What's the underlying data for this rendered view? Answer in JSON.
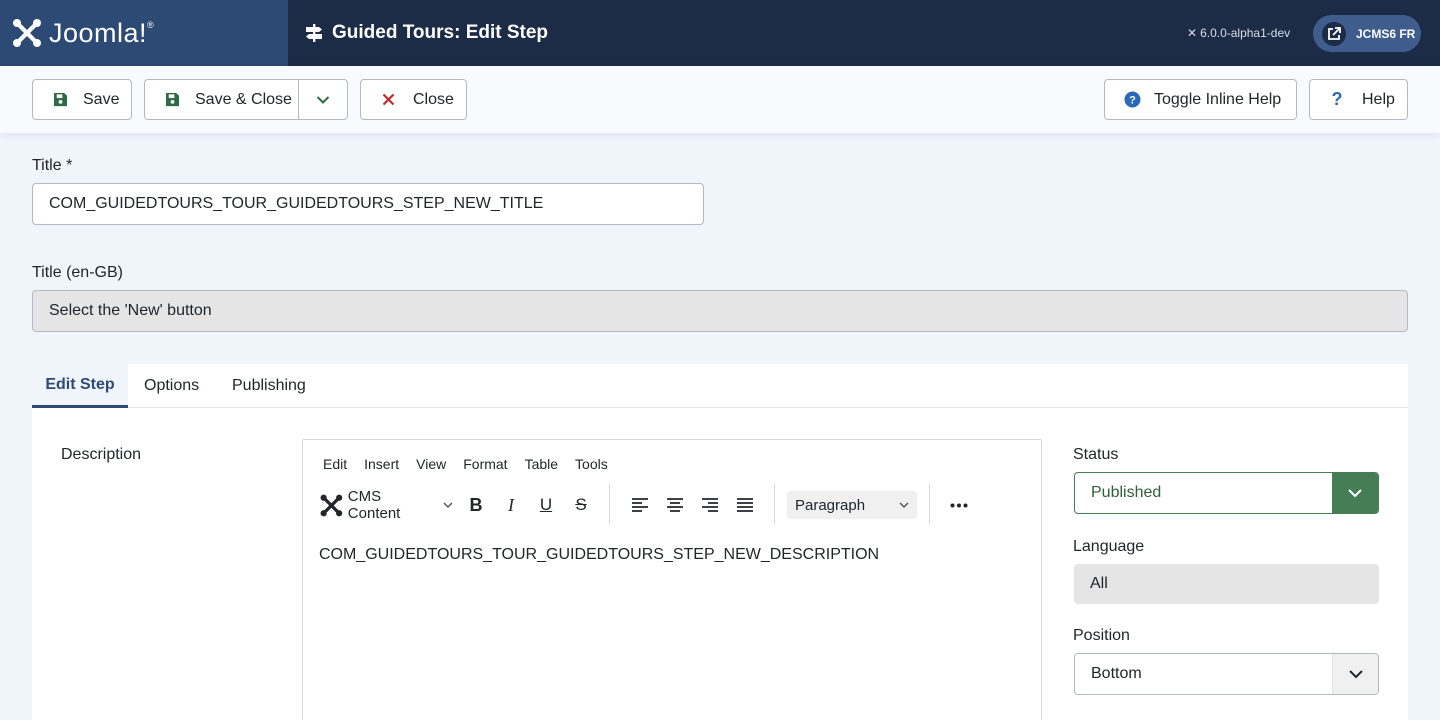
{
  "header": {
    "brand": "Joomla!",
    "brand_mark": "joomla-logo",
    "title": "Guided Tours: Edit Step",
    "version": "6.0.0-alpha1-dev",
    "site_label": "JCMS6 FR"
  },
  "toolbar": {
    "save_label": "Save",
    "save_close_label": "Save & Close",
    "close_label": "Close",
    "toggle_inline_help_label": "Toggle Inline Help",
    "help_label": "Help"
  },
  "form": {
    "title_label": "Title *",
    "title_value": "COM_GUIDEDTOURS_TOUR_GUIDEDTOURS_STEP_NEW_TITLE",
    "title_translation_label": "Title (en-GB)",
    "title_translation_value": "Select the 'New' button"
  },
  "tabs": [
    {
      "label": "Edit Step",
      "active": true
    },
    {
      "label": "Options",
      "active": false
    },
    {
      "label": "Publishing",
      "active": false
    }
  ],
  "description": {
    "label": "Description",
    "menu": [
      "Edit",
      "Insert",
      "View",
      "Format",
      "Table",
      "Tools"
    ],
    "cms_content_label": "CMS Content",
    "block_format": "Paragraph",
    "content": "COM_GUIDEDTOURS_TOUR_GUIDEDTOURS_STEP_NEW_DESCRIPTION"
  },
  "sidebar": {
    "status_label": "Status",
    "status_value": "Published",
    "language_label": "Language",
    "language_value": "All",
    "position_label": "Position",
    "position_value": "Bottom"
  },
  "colors": {
    "header_bg": "#1c2b46",
    "brand_bg": "#2d4a74",
    "status_green": "#457d54",
    "close_red": "#c52827",
    "help_blue": "#2a69b8"
  }
}
